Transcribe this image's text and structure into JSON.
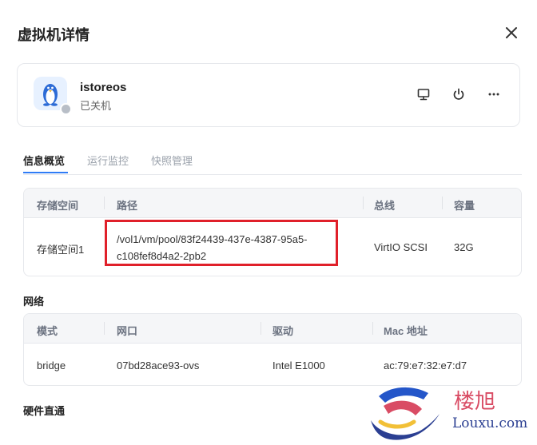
{
  "dialog": {
    "title": "虚拟机详情"
  },
  "vm": {
    "name": "istoreos",
    "state": "已关机"
  },
  "tabs": [
    {
      "label": "信息概览",
      "active": true
    },
    {
      "label": "运行监控",
      "active": false
    },
    {
      "label": "快照管理",
      "active": false
    }
  ],
  "storage": {
    "headers": [
      "存储空间",
      "路径",
      "总线",
      "容量"
    ],
    "rows": [
      {
        "space": "存储空间1",
        "path_line1": "/vol1/vm/pool/83f24439-437e-4387-95a5-",
        "path_line2": "c108fef8d4a2-2pb2",
        "bus": "VirtIO SCSI",
        "capacity": "32G"
      }
    ]
  },
  "network": {
    "title": "网络",
    "headers": [
      "模式",
      "网口",
      "驱动",
      "Mac 地址"
    ],
    "rows": [
      {
        "mode": "bridge",
        "port": "07bd28ace93-ovs",
        "driver": "Intel E1000",
        "mac": "ac:79:e7:32:e7:d7"
      }
    ]
  },
  "passthrough": {
    "title": "硬件直通"
  },
  "watermark": {
    "cn": "楼旭",
    "en": "Louxu.com"
  },
  "colors": {
    "accent": "#2f7cf6",
    "highlight": "#e0202a"
  },
  "icons": {
    "close": "close-icon",
    "avatar": "linux-penguin-icon",
    "monitor": "monitor-icon",
    "power": "power-icon",
    "more": "more-icon"
  }
}
